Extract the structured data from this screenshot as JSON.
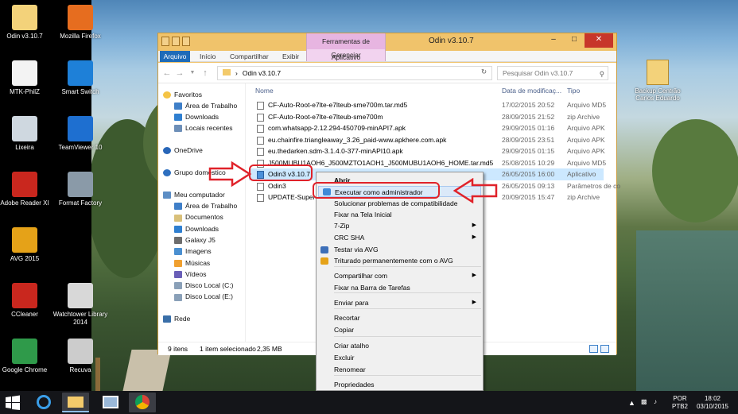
{
  "desktop_left": [
    {
      "label": "Odin v3.10.7",
      "icon": "folder-icon",
      "color": "#f3d27a"
    },
    {
      "label": "Mozilla Firefox",
      "icon": "firefox-icon",
      "color": "#e66d1f"
    },
    {
      "label": "MTK-PhilZ",
      "icon": "document-icon",
      "color": "#f3f3f3"
    },
    {
      "label": "Smart Switch",
      "icon": "smart-switch-icon",
      "color": "#1e80d8"
    },
    {
      "label": "Lixeira",
      "icon": "recycle-bin-icon",
      "color": "#cfd8e0"
    },
    {
      "label": "TeamViewer 10",
      "icon": "teamviewer-icon",
      "color": "#1e6fd0"
    },
    {
      "label": "Adobe Reader XI",
      "icon": "adobe-reader-icon",
      "color": "#c9271e"
    },
    {
      "label": "Format Factory",
      "icon": "format-factory-icon",
      "color": "#8a9aa8"
    },
    {
      "label": "AVG 2015",
      "icon": "avg-icon",
      "color": "#e5a218"
    },
    {
      "label": "CCleaner",
      "icon": "ccleaner-icon",
      "color": "#c9271e"
    },
    {
      "label": "Watchtower Library 2014",
      "icon": "watchtower-icon",
      "color": "#d8d8d8"
    },
    {
      "label": "Google Chrome",
      "icon": "chrome-icon",
      "color": "#2f9a4a"
    },
    {
      "label": "Recuva",
      "icon": "recuva-icon",
      "color": "#cccccc"
    }
  ],
  "desktop_right": {
    "label": "Backup Centrão Carlos Eduardo"
  },
  "window": {
    "title": "Odin v3.10.7",
    "context_tab_group": "Ferramentas de Aplicativo",
    "context_tab": "Gerenciar",
    "tabs": [
      "Arquivo",
      "Início",
      "Compartilhar",
      "Exibir"
    ],
    "path": "Odin v3.10.7",
    "search_placeholder": "Pesquisar Odin v3.10.7"
  },
  "nav": {
    "favoritos": "Favoritos",
    "area_trabalho": "Área de Trabalho",
    "downloads": "Downloads",
    "locais": "Locais recentes",
    "onedrive": "OneDrive",
    "grupo": "Grupo doméstico",
    "computador": "Meu computador",
    "pc_items": [
      "Área de Trabalho",
      "Documentos",
      "Downloads",
      "Galaxy J5",
      "Imagens",
      "Músicas",
      "Vídeos",
      "Disco Local (C:)",
      "Disco Local (E:)"
    ],
    "rede": "Rede"
  },
  "columns": {
    "name": "Nome",
    "date": "Data de modificaç...",
    "type": "Tipo"
  },
  "files": [
    {
      "name": "CF-Auto-Root-e7lte-e7lteub-sme700m.tar.md5",
      "date": "17/02/2015 20:52",
      "type": "Arquivo MD5"
    },
    {
      "name": "CF-Auto-Root-e7lte-e7lteub-sme700m",
      "date": "28/09/2015 21:52",
      "type": "zip Archive"
    },
    {
      "name": "com.whatsapp-2.12.294-450709-minAPI7.apk",
      "date": "29/09/2015 01:16",
      "type": "Arquivo APK"
    },
    {
      "name": "eu.chainfire.triangleaway_3.26_paid-www.apkhere.com.apk",
      "date": "28/09/2015 23:51",
      "type": "Arquivo APK"
    },
    {
      "name": "eu.thedarken.sdm-3.1.4.0-377-minAPI10.apk",
      "date": "29/09/2015 01:15",
      "type": "Arquivo APK"
    },
    {
      "name": "J500MUBU1AOH6_J500MZTO1AOH1_J500MUBU1AOH6_HOME.tar.md5",
      "date": "25/08/2015 10:29",
      "type": "Arquivo MD5"
    },
    {
      "name": "Odin3 v3.10.7",
      "date": "26/05/2015 16:00",
      "type": "Aplicativo"
    },
    {
      "name": "Odin3",
      "date": "26/05/2015 09:13",
      "type": "Parâmetros de co"
    },
    {
      "name": "UPDATE-Super",
      "date": "20/09/2015 15:47",
      "type": "zip Archive"
    }
  ],
  "status": {
    "count": "9 itens",
    "selected": "1 item selecionado",
    "size": "2,35 MB"
  },
  "context_menu": {
    "items": [
      {
        "label": "Abrir",
        "bold": true
      },
      {
        "label": "Executar como administrador",
        "highlight": true
      },
      {
        "label": "Solucionar problemas de compatibilidade"
      },
      {
        "label": "Fixar na Tela Inicial"
      },
      {
        "label": "7-Zip",
        "submenu": true
      },
      {
        "label": "CRC SHA",
        "submenu": true
      },
      {
        "label": "Testar via  AVG"
      },
      {
        "label": "Triturado permanentemente com o AVG"
      },
      {
        "label": "Compartilhar com",
        "submenu": true
      },
      {
        "label": "Fixar na Barra de Tarefas"
      },
      {
        "label": "Enviar para",
        "submenu": true
      },
      {
        "label": "Recortar"
      },
      {
        "label": "Copiar"
      },
      {
        "label": "Criar atalho"
      },
      {
        "label": "Excluir"
      },
      {
        "label": "Renomear"
      },
      {
        "label": "Propriedades"
      }
    ]
  },
  "tray": {
    "lang1": "POR",
    "lang2": "PTB2",
    "time": "18:02",
    "date": "03/10/2015"
  },
  "colors": {
    "accent": "#1e6bb8",
    "annotation": "#e0222a",
    "selection": "#cce8ff"
  }
}
